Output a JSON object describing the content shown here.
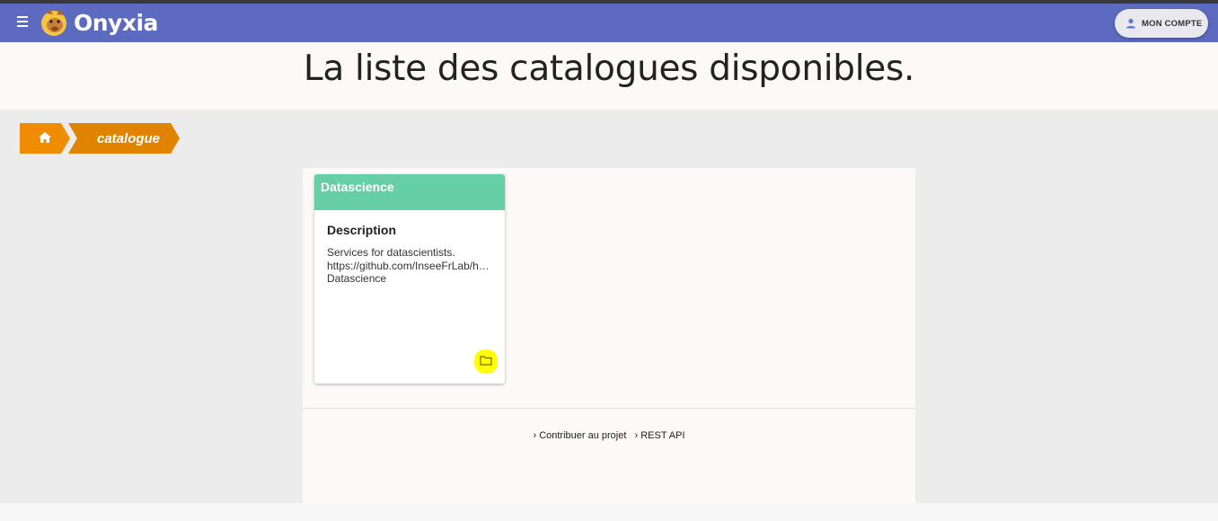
{
  "app": {
    "brand": "Onyxia",
    "account_label": "MON COMPTE"
  },
  "hero": {
    "title": "La liste des catalogues disponibles."
  },
  "breadcrumb": {
    "home_icon": "home-icon",
    "current": "catalogue"
  },
  "catalogs": [
    {
      "name": "Datascience",
      "description_title": "Description",
      "description_lines": [
        "Services for datascientists.",
        "https://github.com/InseeFrLab/helm-charts-datascience",
        "Datascience"
      ],
      "action_icon": "folder-icon"
    }
  ],
  "footer": {
    "links": [
      "Contribuer au projet",
      "REST API"
    ]
  },
  "colors": {
    "appbar": "#5c6bc0",
    "breadcrumb": "#f08c00",
    "card_header": "#66cfa6",
    "highlight": "#ffff00"
  }
}
